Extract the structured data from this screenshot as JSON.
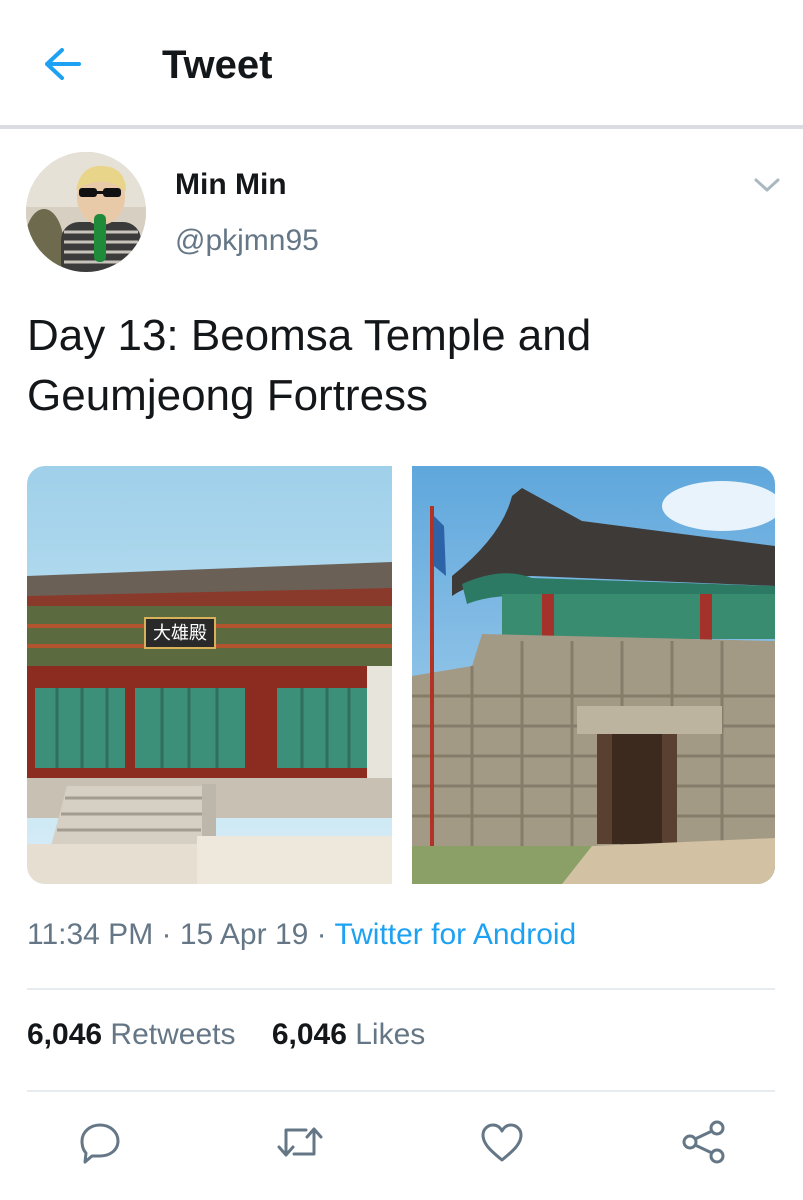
{
  "header": {
    "title": "Tweet",
    "back_icon": "arrow-left-icon"
  },
  "colors": {
    "accent": "#1da1f2",
    "secondary_text": "#657786",
    "primary_text": "#14171a"
  },
  "author": {
    "display_name": "Min Min",
    "handle": "@pkjmn95"
  },
  "tweet": {
    "text": "Day 13: Beomsa Temple and Geumjeong Fortress",
    "media": [
      {
        "subject": "Beomsa Temple hall"
      },
      {
        "subject": "Geumjeong Fortress gate"
      }
    ],
    "time": "11:34 PM",
    "date": "15 Apr 19",
    "separator": "·",
    "source": "Twitter for Android"
  },
  "stats": {
    "retweets_count": "6,046",
    "retweets_label": "Retweets",
    "likes_count": "6,046",
    "likes_label": "Likes"
  },
  "actions": [
    "reply-icon",
    "retweet-icon",
    "like-icon",
    "share-icon"
  ]
}
